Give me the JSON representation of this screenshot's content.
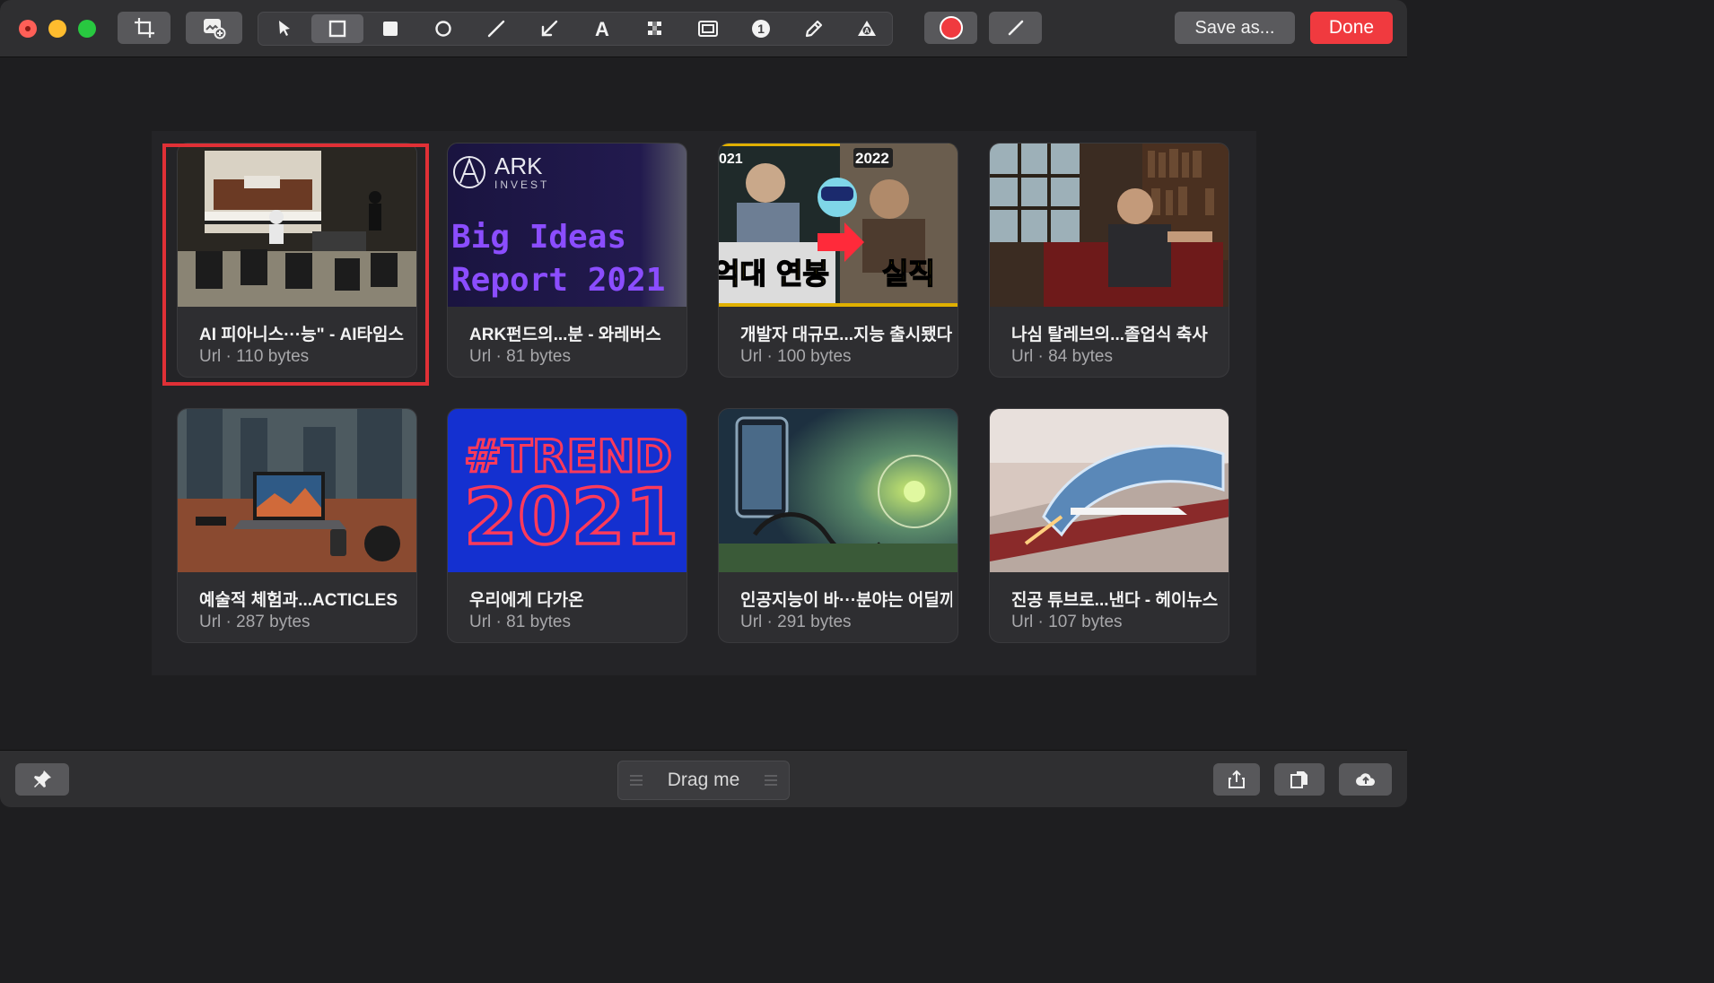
{
  "toolbar": {
    "crop_tool": "crop-icon",
    "add_image_tool": "add-image-icon",
    "tools": [
      {
        "icon": "arrow-pointer-icon"
      },
      {
        "icon": "rectangle-outline-icon",
        "active": true
      },
      {
        "icon": "rectangle-filled-icon"
      },
      {
        "icon": "circle-icon"
      },
      {
        "icon": "line-icon"
      },
      {
        "icon": "arrow-icon"
      },
      {
        "icon": "text-icon",
        "glyph": "A"
      },
      {
        "icon": "pixelate-icon"
      },
      {
        "icon": "highlight-icon"
      },
      {
        "icon": "counter-icon",
        "glyph": "1"
      },
      {
        "icon": "pencil-icon"
      },
      {
        "icon": "marker-icon"
      }
    ],
    "color": "#f03a3f",
    "stroke_tool": "stroke-width-icon",
    "save_label": "Save as...",
    "done_label": "Done"
  },
  "cards": [
    {
      "title": "AI 피아니스···능\" - AI타임스",
      "subtitle": "Url · 110 bytes",
      "highlighted": true
    },
    {
      "title": "ARK펀드의...분 - 와레버스",
      "subtitle": "Url · 81 bytes",
      "thumb_text": {
        "brand": "ARK",
        "brand_sub": "INVEST",
        "line1": "Big Ideas",
        "line2": "Report 2021"
      }
    },
    {
      "title": "개발자 대규모...지능 출시됐다",
      "subtitle": "Url · 100 bytes",
      "thumb_text": {
        "year_left": "021",
        "year_right": "2022",
        "left": "억대 연봉",
        "right": "실직"
      }
    },
    {
      "title": "나심 탈레브의...졸업식 축사",
      "subtitle": "Url · 84 bytes"
    },
    {
      "title": "예술적 체험과...ACTICLES",
      "subtitle": "Url · 287 bytes"
    },
    {
      "title": "우리에게 다가온",
      "subtitle": "Url · 81 bytes",
      "thumb_text": {
        "top": "#TREND",
        "bottom": "2021"
      }
    },
    {
      "title": "인공지능이 바···분야는 어딜까",
      "subtitle": "Url · 291 bytes"
    },
    {
      "title": "진공 튜브로...낸다 - 헤이뉴스",
      "subtitle": "Url · 107 bytes"
    }
  ],
  "bottombar": {
    "pin": "pin-icon",
    "drag_label": "Drag me",
    "share": "share-icon",
    "copy": "copy-icon",
    "upload": "cloud-upload-icon"
  }
}
